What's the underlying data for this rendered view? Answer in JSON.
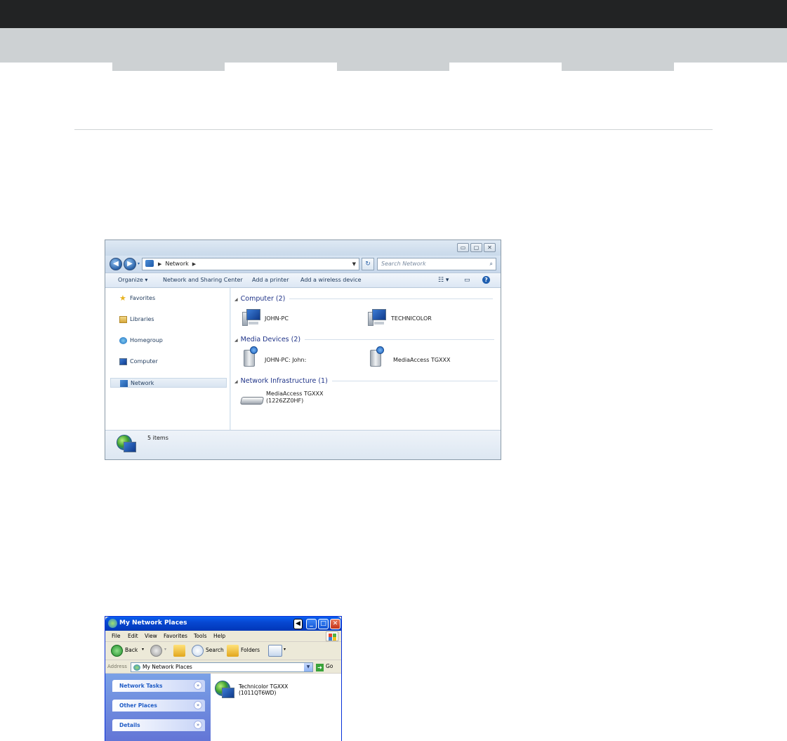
{
  "win7": {
    "address": "Network",
    "search_placeholder": "Search Network",
    "caption": {
      "minimize": "▭",
      "maximize": "▢",
      "close": "✕"
    },
    "commands": [
      "Organize ▾",
      "Network and Sharing Center",
      "Add a printer",
      "Add a wireless device"
    ],
    "nav": [
      {
        "label": "Favorites",
        "icon": "star-icon"
      },
      {
        "label": "Libraries",
        "icon": "libraries-icon"
      },
      {
        "label": "Homegroup",
        "icon": "homegroup-icon"
      },
      {
        "label": "Computer",
        "icon": "computer-icon"
      },
      {
        "label": "Network",
        "icon": "network-icon",
        "selected": true
      }
    ],
    "groups": {
      "computer": {
        "title": "Computer (2)",
        "items": [
          "JOHN-PC",
          "TECHNICOLOR"
        ]
      },
      "media": {
        "title": "Media Devices (2)",
        "items": [
          "JOHN-PC: John:",
          "MediaAccess TGXXX"
        ]
      },
      "infra": {
        "title": "Network Infrastructure (1)",
        "item_line1": "MediaAccess TGXXX",
        "item_line2": "(1226ZZ0HF)"
      }
    },
    "status": "5 items"
  },
  "xp": {
    "title": "My Network Places",
    "menu": [
      "File",
      "Edit",
      "View",
      "Favorites",
      "Tools",
      "Help"
    ],
    "toolbar": {
      "back": "Back",
      "search": "Search",
      "folders": "Folders"
    },
    "address_label": "Address",
    "address_value": "My Network Places",
    "go": "Go",
    "tasks": [
      "Network Tasks",
      "Other Places",
      "Details"
    ],
    "item_line1": "Technicolor TGXXX",
    "item_line2": "(1011QT6WD)"
  }
}
